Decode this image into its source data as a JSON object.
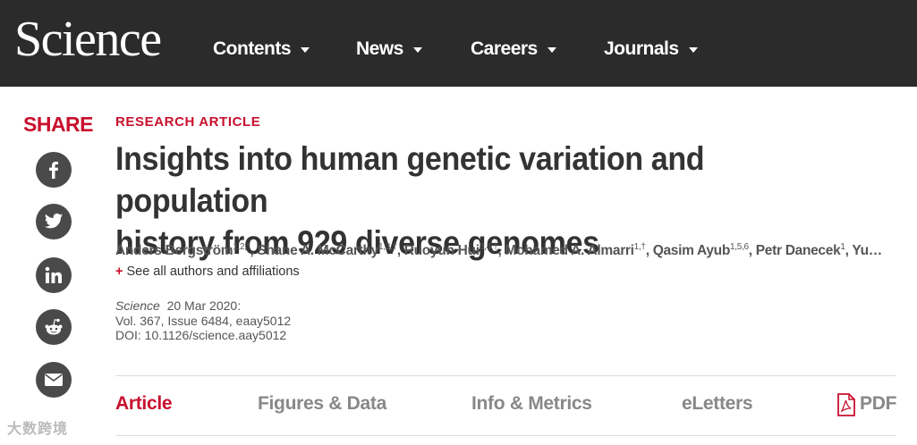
{
  "header": {
    "logo": "Science",
    "nav": [
      {
        "label": "Contents"
      },
      {
        "label": "News"
      },
      {
        "label": "Careers"
      },
      {
        "label": "Journals"
      }
    ]
  },
  "share": {
    "label": "SHARE",
    "icons": [
      "facebook-icon",
      "twitter-icon",
      "linkedin-icon",
      "reddit-icon",
      "email-icon"
    ]
  },
  "article": {
    "kicker": "RESEARCH ARTICLE",
    "title_line1": "Insights into human genetic variation and population",
    "title_line2": "history from 929 diverse genomes",
    "authors": [
      {
        "name": "Anders Bergström",
        "sup": "1,2,*"
      },
      {
        "name": "Shane A. McCarthy",
        "sup": "1,3,†"
      },
      {
        "name": "Ruoyun Hui",
        "sup": "3,4,†"
      },
      {
        "name": "Mohamed A. Almarri",
        "sup": "1,†"
      },
      {
        "name": "Qasim Ayub",
        "sup": "1,5,6"
      },
      {
        "name": "Petr Danecek",
        "sup": "1"
      }
    ],
    "authors_tail": "Yu…",
    "see_all": "See all authors and affiliations",
    "journal": "Science",
    "date": "20 Mar 2020:",
    "volume": "Vol. 367, Issue 6484, eaay5012",
    "doi": "DOI: 10.1126/science.aay5012"
  },
  "tabs": [
    {
      "label": "Article"
    },
    {
      "label": "Figures & Data"
    },
    {
      "label": "Info & Metrics"
    },
    {
      "label": "eLetters"
    },
    {
      "label": "PDF"
    }
  ],
  "watermark": "大数跨境",
  "colors": {
    "accent": "#c8102e",
    "header_bg": "#2b2b2b",
    "icon_bg": "#4a4a4a"
  }
}
